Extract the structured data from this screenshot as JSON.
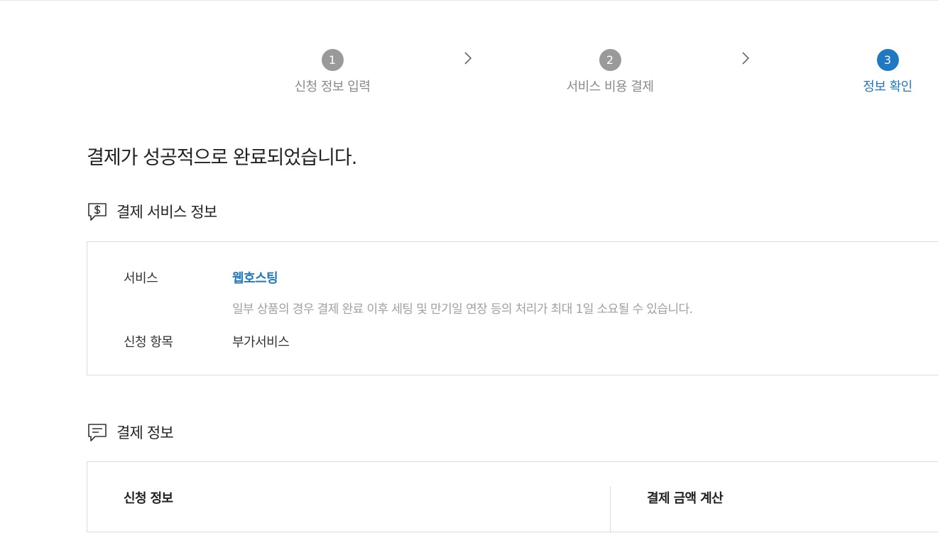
{
  "stepper": {
    "steps": [
      {
        "number": "1",
        "label": "신청 정보 입력",
        "state": "done"
      },
      {
        "number": "2",
        "label": "서비스 비용 결제",
        "state": "done"
      },
      {
        "number": "3",
        "label": "정보 확인",
        "state": "active"
      }
    ],
    "arrow_icon": "chevron-right-icon"
  },
  "heading": "결제가 성공적으로 완료되었습니다.",
  "service_section": {
    "icon": "dollar-speech-bubble-icon",
    "title": "결제 서비스 정보",
    "rows": {
      "service_label": "서비스",
      "service_value": "웹호스팅",
      "notice": "일부 상품의 경우 결제 완료 이후 세팅 및 만기일 연장 등의 처리가 최대 1일 소요될 수 있습니다.",
      "item_label": "신청 항목",
      "item_value": "부가서비스"
    }
  },
  "payment_section": {
    "icon": "message-lines-icon",
    "title": "결제 정보",
    "left_title": "신청 정보",
    "right_title": "결제 금액 계산"
  },
  "colors": {
    "accent": "#1f78c1",
    "inactive_step": "#9a9a9a",
    "muted_text": "#a0a0a0",
    "border": "#dcdcdc"
  }
}
